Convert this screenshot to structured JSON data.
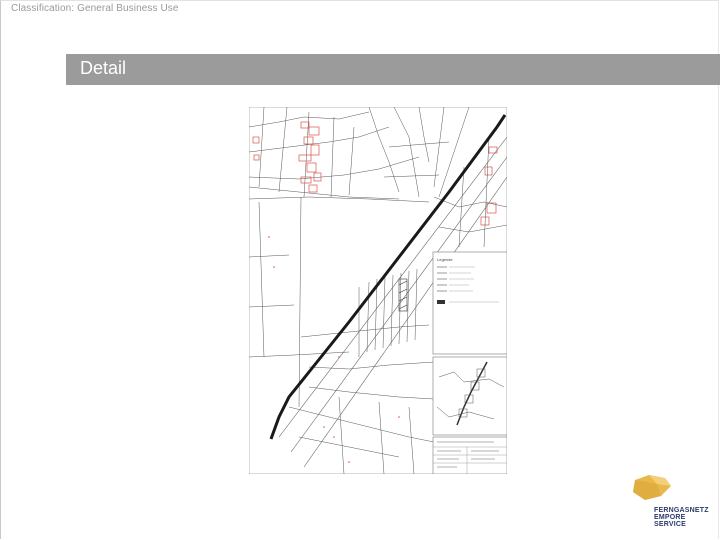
{
  "header": {
    "classification": "Classification: General Business Use"
  },
  "slide": {
    "title": "Detail"
  },
  "map": {
    "icon": "site-plan-map",
    "legend_title": "Legende",
    "stamp_label": "Detail"
  },
  "logo": {
    "icon": "company-logo",
    "color": "#e8b84a",
    "lines": [
      "FERNGASNETZ",
      "EMPORE",
      "SERVICE"
    ]
  },
  "colors": {
    "title_bar": "#9b9b9b",
    "pipeline": "#1a1a1a",
    "cadastral_red": "#d9534f"
  }
}
